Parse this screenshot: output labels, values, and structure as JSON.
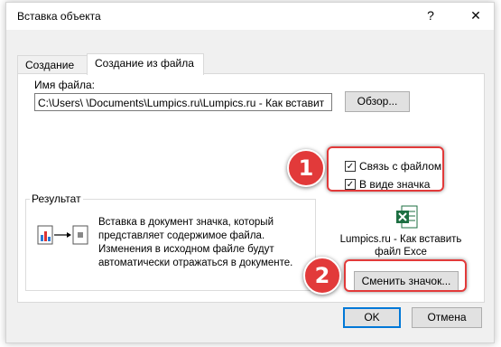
{
  "dialog": {
    "title": "Вставка объекта",
    "help_label": "?",
    "close_label": "✕"
  },
  "tabs": [
    {
      "label": "Создание",
      "active": false
    },
    {
      "label": "Создание из файла",
      "active": true
    }
  ],
  "file": {
    "label": "Имя файла:",
    "value": "C:\\Users\\        \\Documents\\Lumpics.ru\\Lumpics.ru - Как вставит",
    "browse_label": "Обзор..."
  },
  "options": {
    "link_label": "Связь с файлом",
    "link_checked": true,
    "icon_label": "В виде значка",
    "icon_checked": true
  },
  "result": {
    "title": "Результат",
    "text": "Вставка в документ значка, который представляет содержимое файла. Изменения в исходном файле будут автоматически отражаться в документе."
  },
  "icon_preview": {
    "icon": "excel-file-icon",
    "caption": "Lumpics.ru - Как вставить файл Exce"
  },
  "change_icon_label": "Сменить значок...",
  "buttons": {
    "ok": "OK",
    "cancel": "Отмена"
  },
  "annotations": [
    {
      "number": "1"
    },
    {
      "number": "2"
    }
  ],
  "colors": {
    "highlight": "#e23a3a",
    "excel_green": "#1d6f42"
  }
}
